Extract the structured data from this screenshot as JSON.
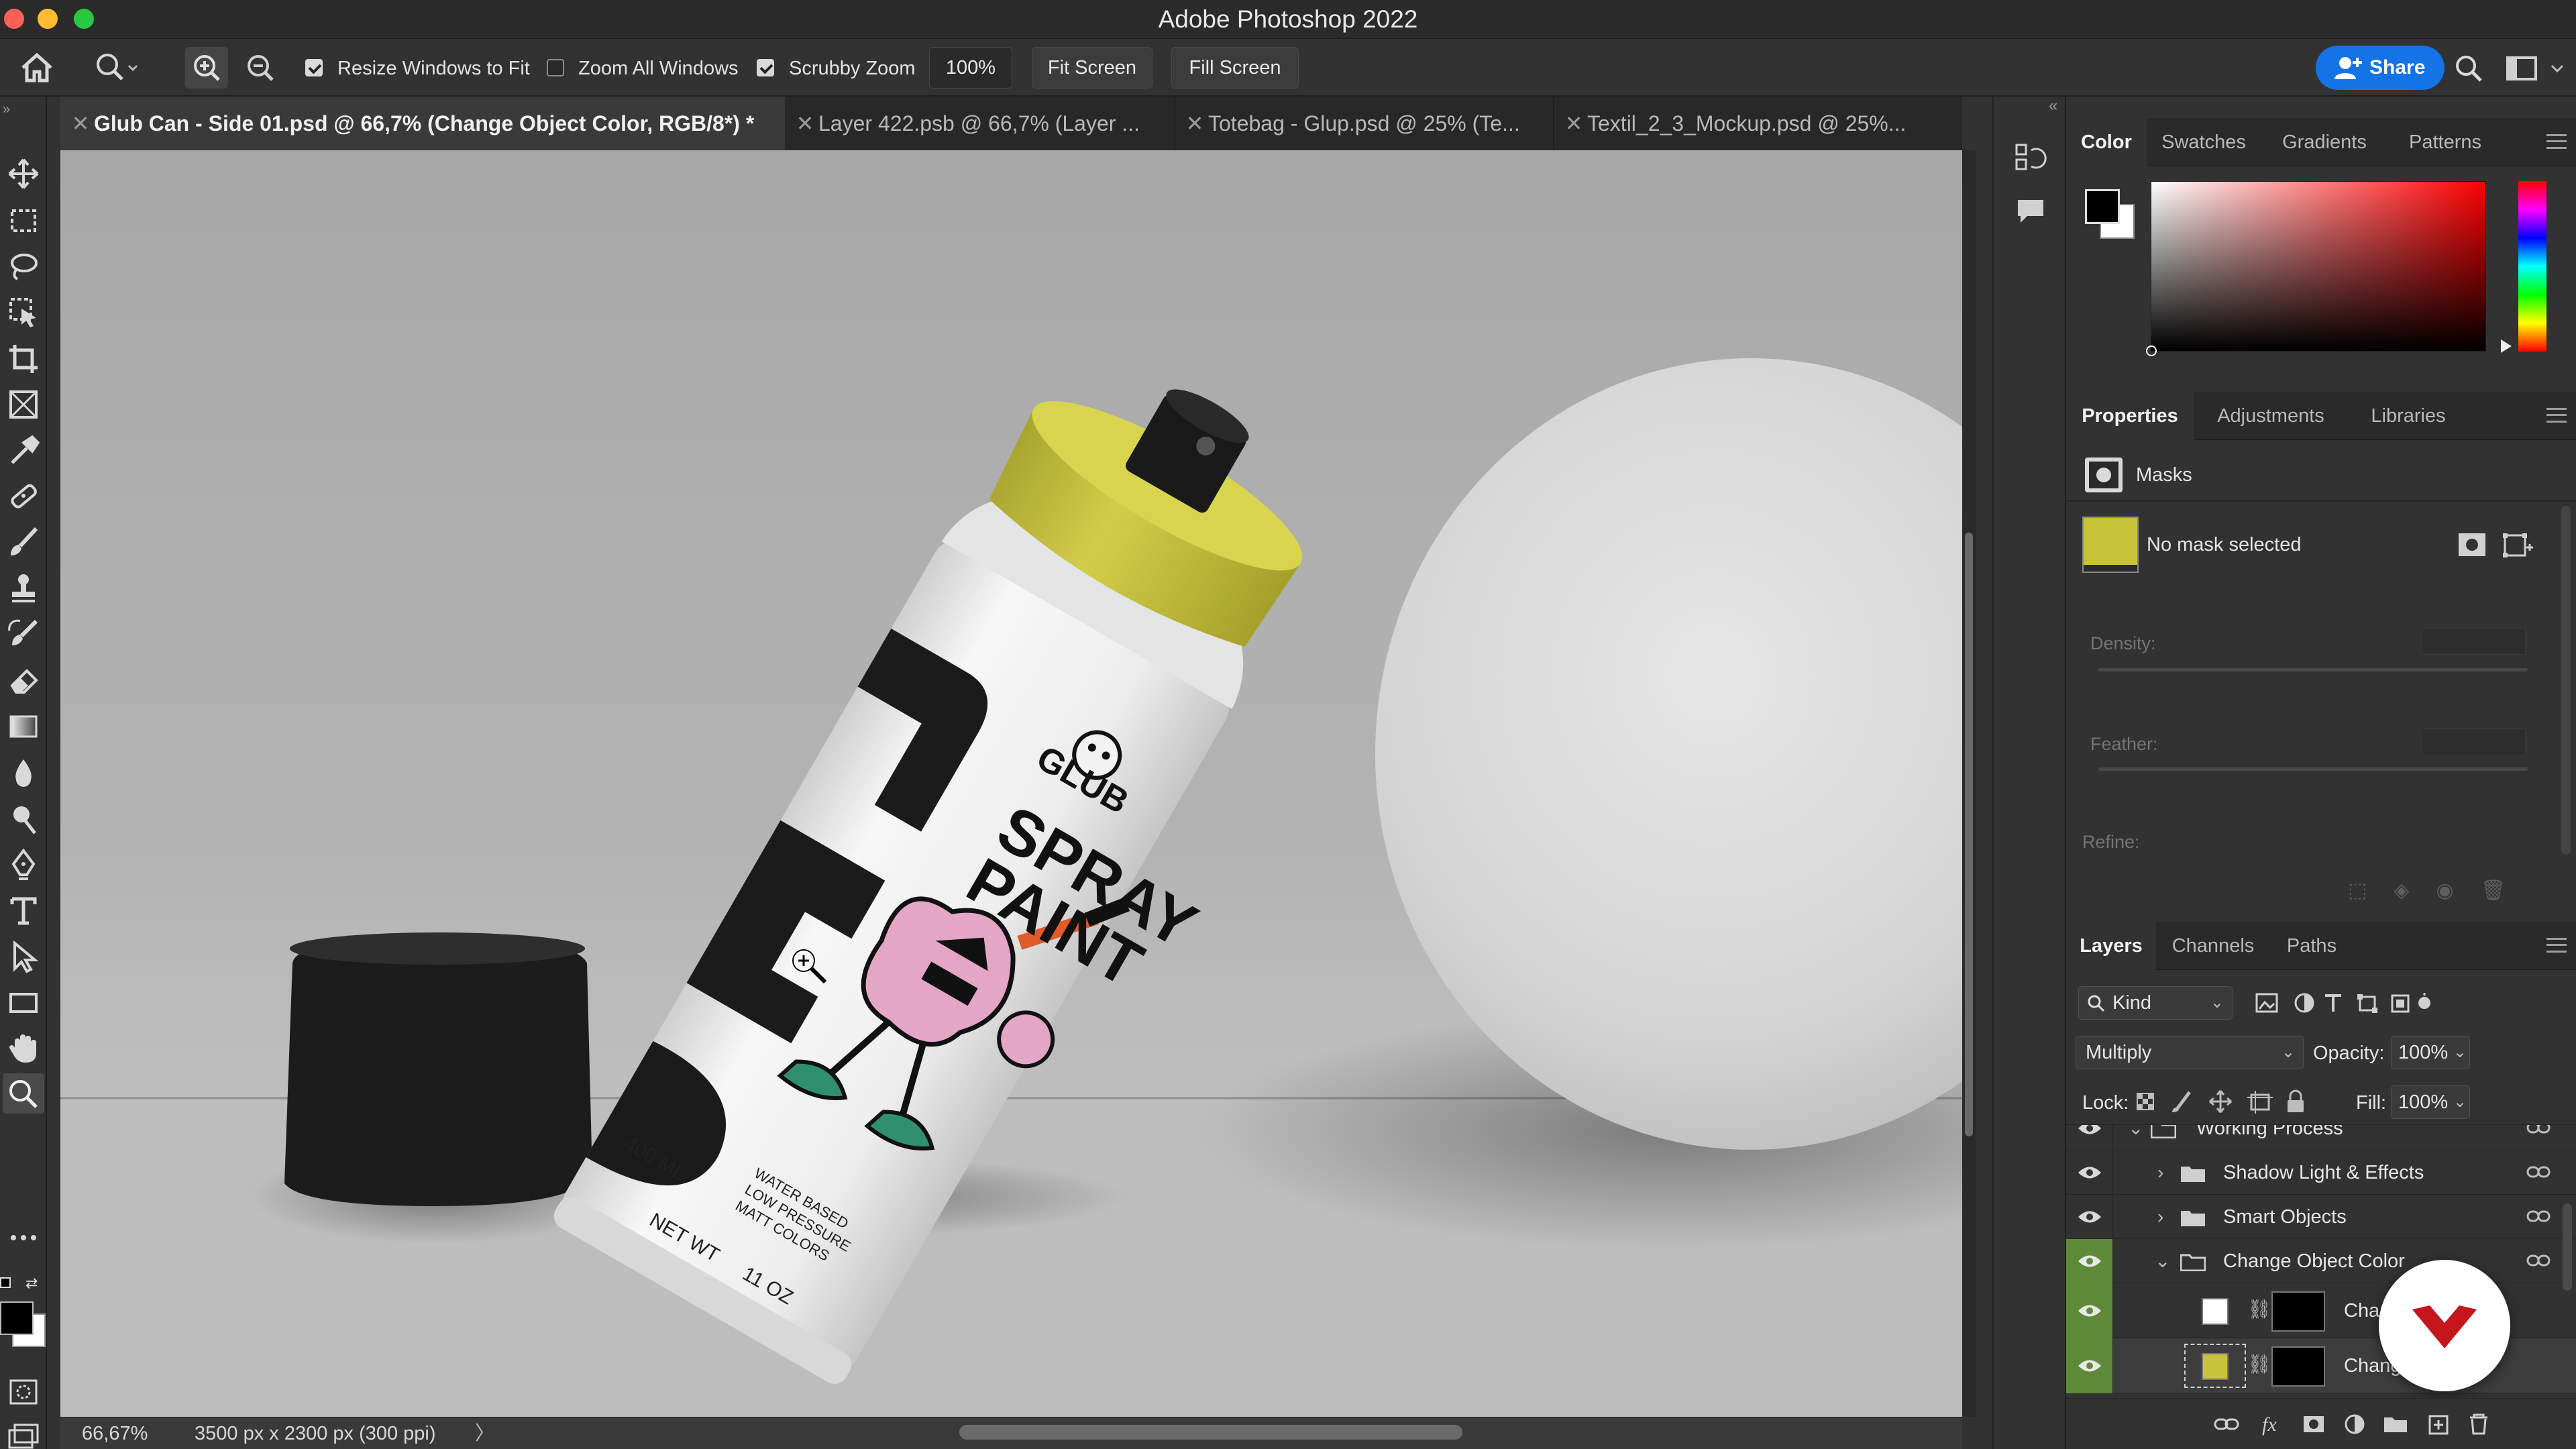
{
  "window": {
    "title": "Adobe Photoshop 2022",
    "traffic_colors": [
      "#fe5f57",
      "#febc2e",
      "#28c840"
    ]
  },
  "options_bar": {
    "resize_windows": {
      "label": "Resize Windows to Fit",
      "checked": true
    },
    "zoom_all": {
      "label": "Zoom All Windows",
      "checked": false
    },
    "scrubby_zoom": {
      "label": "Scrubby Zoom",
      "checked": true
    },
    "zoom_value": "100%",
    "fit_screen": "Fit Screen",
    "fill_screen": "Fill Screen",
    "share": "Share"
  },
  "tabs": [
    {
      "label": "Glub Can - Side 01.psd @ 66,7% (Change Object Color, RGB/8*) *",
      "active": true
    },
    {
      "label": "Layer 422.psb @ 66,7% (Layer ...",
      "active": false
    },
    {
      "label": "Totebag - Glup.psd @ 25% (Te...",
      "active": false
    },
    {
      "label": "Textil_2_3_Mockup.psd @ 25%...",
      "active": false
    }
  ],
  "canvas": {
    "can_brand": "GLUB",
    "can_title_line1": "SPRAY",
    "can_title_line2": "PAINT",
    "can_volume": "400 ML",
    "can_netwt": "NET WT",
    "can_oz": "11 OZ",
    "can_desc": [
      "WATER BASED",
      "LOW PRESSURE",
      "MATT COLORS"
    ],
    "cap_color": "#c9c33c"
  },
  "status_bar": {
    "zoom": "66,67%",
    "doc_size": "3500 px x 2300 px (300 ppi)"
  },
  "color_panel": {
    "tabs": [
      "Color",
      "Swatches",
      "Gradients",
      "Patterns"
    ],
    "active": "Color",
    "foreground": "#000000",
    "background": "#ffffff",
    "hue": "#ff0000"
  },
  "properties_panel": {
    "tabs": [
      "Properties",
      "Adjustments",
      "Libraries"
    ],
    "active": "Properties",
    "section": "Masks",
    "mask_status": "No mask selected",
    "density_label": "Density:",
    "feather_label": "Feather:",
    "refine_label": "Refine:",
    "thumb_color": "#c9c33c"
  },
  "layers_panel": {
    "tabs": [
      "Layers",
      "Channels",
      "Paths"
    ],
    "active": "Layers",
    "filter_kind": "Kind",
    "blend_mode": "Multiply",
    "opacity_label": "Opacity:",
    "opacity": "100%",
    "lock_label": "Lock:",
    "fill_label": "Fill:",
    "fill": "100%",
    "layers": [
      {
        "name": "Working Process",
        "type": "group",
        "expanded": true
      },
      {
        "name": "Shadow Light & Effects",
        "type": "group",
        "expanded": false
      },
      {
        "name": "Smart Objects",
        "type": "group",
        "expanded": false
      },
      {
        "name": "Change Object Color",
        "type": "group",
        "expanded": true
      },
      {
        "name": "Chan",
        "type": "layer",
        "thumb": "#ffffff"
      },
      {
        "name": "Chang",
        "type": "layer",
        "thumb": "#c9c33c"
      }
    ]
  }
}
